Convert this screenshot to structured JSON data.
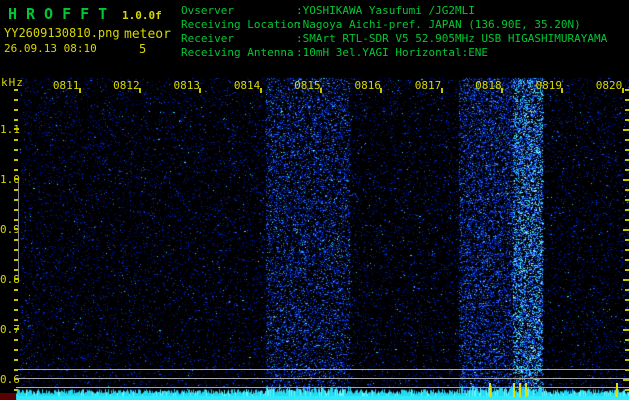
{
  "header": {
    "app_title": "HROFFT",
    "version": "1.0.0f",
    "filename": "YY2609130810.png",
    "mode_label": "meteor",
    "datetime": "26.09.13 08:10",
    "meteor_count": "5",
    "info_separator": ":",
    "info": [
      {
        "key": "Ovserver",
        "value": "YOSHIKAWA Yasufumi /JG2MLI"
      },
      {
        "key": "Receiving Location",
        "value": "Nagoya Aichi-pref. JAPAN (136.90E, 35.20N)"
      },
      {
        "key": "Receiver",
        "value": "SMArt RTL-SDR V5 52.905MHz USB HIGASHIMURAYAMA"
      },
      {
        "key": "Receiving Antenna",
        "value": "10mH 3el.YAGI Horizontal:ENE"
      }
    ]
  },
  "chart_data": {
    "type": "heatmap",
    "title": "HROFFT radio meteor echo spectrogram 0810-0820",
    "ylabel": "kHz",
    "xlabel_ticks": [
      "0811",
      "0812",
      "0813",
      "0814",
      "0815",
      "0816",
      "0817",
      "0818",
      "0819",
      "0820"
    ],
    "ytick_labels": [
      "1.1",
      "1.0",
      "0.9",
      "0.8",
      "0.7",
      "0.6"
    ],
    "ytick_values_khz": [
      1.1,
      1.0,
      0.9,
      0.8,
      0.7,
      0.6
    ],
    "y_range_khz": [
      0.56,
      1.2
    ],
    "x_start": "0810",
    "x_end": "0820",
    "grid": false,
    "activity_bands": [
      {
        "start_min_after_0810": 4.1,
        "end_min_after_0810": 5.5,
        "intensity": "medium"
      },
      {
        "start_min_after_0810": 7.3,
        "end_min_after_0810": 8.2,
        "intensity": "high"
      },
      {
        "start_min_after_0810": 8.2,
        "end_min_after_0810": 8.7,
        "intensity": "very_high"
      }
    ],
    "meteor_markers_min_after_0810": [
      7.8,
      8.2,
      8.3,
      8.4,
      9.9
    ],
    "meteor_count": 5,
    "baseline_lines_khz": [
      0.62,
      0.602,
      0.584
    ],
    "carrier_band_khz": 0.57
  },
  "colors": {
    "bg": "#000000",
    "text_green": "#00c832",
    "text_yellow": "#d8d800",
    "axis_yellow": "#c8c800",
    "gray_line": "#a8a8a8",
    "carrier_cyan": "#2cecff",
    "marker_yellow": "#e0e000",
    "dark_red": "#5a0000",
    "noise_dark": [
      "#000d66",
      "#001e99",
      "#0030cc",
      "#2a5aff",
      "#39e0e8"
    ],
    "noise_bright": [
      "#001e99",
      "#0030cc",
      "#2a5aff",
      "#3f7fff",
      "#22c8e0",
      "#7fffff"
    ],
    "noise_peak": [
      "#0030cc",
      "#2a5aff",
      "#3fa0ff",
      "#30e0f0",
      "#aaffff"
    ]
  }
}
